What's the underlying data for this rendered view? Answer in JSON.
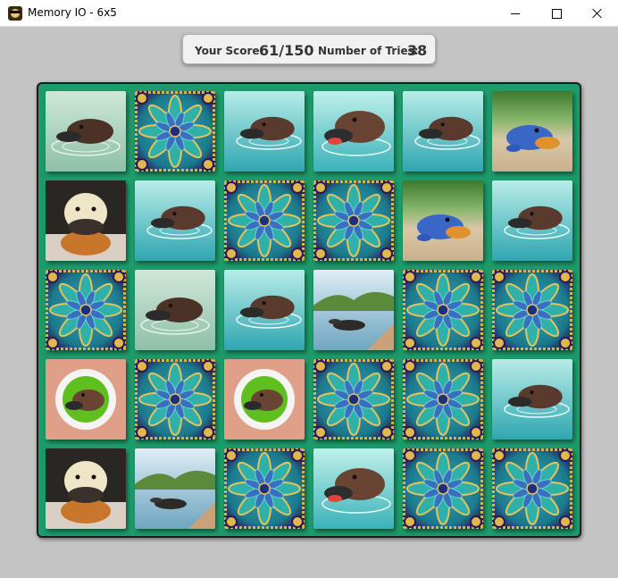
{
  "window": {
    "title": "Memory IO - 6x5"
  },
  "score": {
    "score_label": "Your Score:",
    "score_value": "61/150",
    "tries_label": "Number of Tries:",
    "tries_value": "38"
  },
  "board": {
    "rows": 5,
    "cols": 6,
    "cards": [
      [
        "platypus-mud-swimming",
        "card-back",
        "platypus-water-close",
        "platypus-water-open-mouth",
        "platypus-water-close",
        "platypus-blue-toy"
      ],
      [
        "platypus-cream-toy",
        "platypus-water-close",
        "card-back",
        "card-back",
        "platypus-blue-toy",
        "platypus-water-close"
      ],
      [
        "card-back",
        "platypus-mud-swimming",
        "platypus-water-close",
        "platypus-lake-landscape",
        "card-back",
        "card-back"
      ],
      [
        "platypus-plate",
        "card-back",
        "platypus-plate",
        "card-back",
        "card-back",
        "platypus-water-close"
      ],
      [
        "platypus-cream-toy",
        "platypus-lake-landscape",
        "card-back",
        "platypus-water-open-mouth",
        "card-back",
        "card-back"
      ]
    ]
  }
}
